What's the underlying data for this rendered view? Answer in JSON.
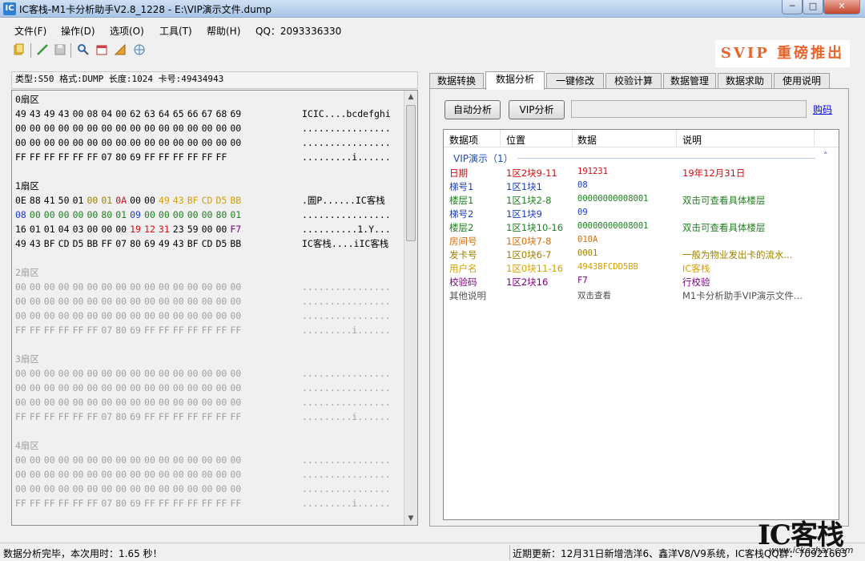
{
  "window": {
    "title": "IC客栈-M1卡分析助手V2.8_1228 -  E:\\VIP演示文件.dump",
    "controls": {
      "minimize": "─",
      "maximize": "□",
      "close": "✕"
    },
    "icon_text": "IC"
  },
  "menu": [
    "文件(F)",
    "操作(D)",
    "选项(O)",
    "工具(T)",
    "帮助(H)",
    "QQ：2093336330"
  ],
  "toolbar_icons": [
    "open-folder-icon",
    "save-disk-icon",
    "edit-pen-icon",
    "disabled-save-icon",
    "search-icon",
    "calendar-icon",
    "chart-icon",
    "network-icon"
  ],
  "banner": "SVIP 重磅推出",
  "info_line": "类型:S50 格式:DUMP 长度:1024 卡号:49434943",
  "sectors": [
    {
      "title": "0扇区",
      "dim": false,
      "rows": [
        {
          "bytes": [
            "49",
            "43",
            "49",
            "43",
            "00",
            "08",
            "04",
            "00",
            "62",
            "63",
            "64",
            "65",
            "66",
            "67",
            "68",
            "69"
          ],
          "ascii": "ICIC....bcdefghi"
        },
        {
          "bytes": [
            "00",
            "00",
            "00",
            "00",
            "00",
            "00",
            "00",
            "00",
            "00",
            "00",
            "00",
            "00",
            "00",
            "00",
            "00",
            "00"
          ],
          "ascii": "................"
        },
        {
          "bytes": [
            "00",
            "00",
            "00",
            "00",
            "00",
            "00",
            "00",
            "00",
            "00",
            "00",
            "00",
            "00",
            "00",
            "00",
            "00",
            "00"
          ],
          "ascii": "................"
        },
        {
          "bytes": [
            "FF",
            "FF",
            "FF",
            "FF",
            "FF",
            "FF",
            "07",
            "80",
            "69",
            "FF",
            "FF",
            "FF",
            "FF",
            "FF",
            "FF"
          ],
          "ascii": ".........i......"
        }
      ]
    },
    {
      "title": "1扇区",
      "dim": false,
      "rows": [
        {
          "bytes": [
            "0E",
            "88",
            "41",
            "50",
            "01",
            "00",
            "01",
            "0A",
            "00",
            "00",
            "49",
            "43",
            "BF",
            "CD",
            "D5",
            "BB"
          ],
          "colors": [
            "",
            "",
            "",
            "",
            "",
            "#a08000",
            "#a08000",
            "#d01010",
            "",
            "",
            "#d6a000",
            "#d6a000",
            "#d6a000",
            "#d6a000",
            "#d6a000",
            "#d6a000"
          ],
          "ascii": ".圄P......IC客栈"
        },
        {
          "bytes": [
            "08",
            "00",
            "00",
            "00",
            "00",
            "00",
            "80",
            "01",
            "09",
            "00",
            "00",
            "00",
            "00",
            "00",
            "80",
            "01"
          ],
          "colors": [
            "#1a3fc0",
            "#208020",
            "#208020",
            "#208020",
            "#208020",
            "#208020",
            "#208020",
            "#208020",
            "#1a3fc0",
            "#208020",
            "#208020",
            "#208020",
            "#208020",
            "#208020",
            "#208020",
            "#208020"
          ],
          "ascii": "................"
        },
        {
          "bytes": [
            "16",
            "01",
            "01",
            "04",
            "03",
            "00",
            "00",
            "00",
            "19",
            "12",
            "31",
            "23",
            "59",
            "00",
            "00",
            "F7"
          ],
          "colors": [
            "",
            "",
            "",
            "",
            "",
            "",
            "",
            "",
            "#d01010",
            "#d01010",
            "#d01010",
            "",
            "",
            "",
            "",
            "#800080"
          ],
          "ascii": "..........1.Y..."
        },
        {
          "bytes": [
            "49",
            "43",
            "BF",
            "CD",
            "D5",
            "BB",
            "FF",
            "07",
            "80",
            "69",
            "49",
            "43",
            "BF",
            "CD",
            "D5",
            "BB"
          ],
          "ascii": "IC客栈....iIC客栈"
        }
      ]
    },
    {
      "title": "2扇区",
      "dim": true,
      "rows": [
        {
          "bytes": [
            "00",
            "00",
            "00",
            "00",
            "00",
            "00",
            "00",
            "00",
            "00",
            "00",
            "00",
            "00",
            "00",
            "00",
            "00",
            "00"
          ],
          "ascii": "................"
        },
        {
          "bytes": [
            "00",
            "00",
            "00",
            "00",
            "00",
            "00",
            "00",
            "00",
            "00",
            "00",
            "00",
            "00",
            "00",
            "00",
            "00",
            "00"
          ],
          "ascii": "................"
        },
        {
          "bytes": [
            "00",
            "00",
            "00",
            "00",
            "00",
            "00",
            "00",
            "00",
            "00",
            "00",
            "00",
            "00",
            "00",
            "00",
            "00",
            "00"
          ],
          "ascii": "................"
        },
        {
          "bytes": [
            "FF",
            "FF",
            "FF",
            "FF",
            "FF",
            "FF",
            "07",
            "80",
            "69",
            "FF",
            "FF",
            "FF",
            "FF",
            "FF",
            "FF",
            "FF"
          ],
          "ascii": ".........i......"
        }
      ]
    },
    {
      "title": "3扇区",
      "dim": true,
      "rows": [
        {
          "bytes": [
            "00",
            "00",
            "00",
            "00",
            "00",
            "00",
            "00",
            "00",
            "00",
            "00",
            "00",
            "00",
            "00",
            "00",
            "00",
            "00"
          ],
          "ascii": "................"
        },
        {
          "bytes": [
            "00",
            "00",
            "00",
            "00",
            "00",
            "00",
            "00",
            "00",
            "00",
            "00",
            "00",
            "00",
            "00",
            "00",
            "00",
            "00"
          ],
          "ascii": "................"
        },
        {
          "bytes": [
            "00",
            "00",
            "00",
            "00",
            "00",
            "00",
            "00",
            "00",
            "00",
            "00",
            "00",
            "00",
            "00",
            "00",
            "00",
            "00"
          ],
          "ascii": "................"
        },
        {
          "bytes": [
            "FF",
            "FF",
            "FF",
            "FF",
            "FF",
            "FF",
            "07",
            "80",
            "69",
            "FF",
            "FF",
            "FF",
            "FF",
            "FF",
            "FF",
            "FF"
          ],
          "ascii": ".........i......"
        }
      ]
    },
    {
      "title": "4扇区",
      "dim": true,
      "rows": [
        {
          "bytes": [
            "00",
            "00",
            "00",
            "00",
            "00",
            "00",
            "00",
            "00",
            "00",
            "00",
            "00",
            "00",
            "00",
            "00",
            "00",
            "00"
          ],
          "ascii": "................"
        },
        {
          "bytes": [
            "00",
            "00",
            "00",
            "00",
            "00",
            "00",
            "00",
            "00",
            "00",
            "00",
            "00",
            "00",
            "00",
            "00",
            "00",
            "00"
          ],
          "ascii": "................"
        },
        {
          "bytes": [
            "00",
            "00",
            "00",
            "00",
            "00",
            "00",
            "00",
            "00",
            "00",
            "00",
            "00",
            "00",
            "00",
            "00",
            "00",
            "00"
          ],
          "ascii": "................"
        },
        {
          "bytes": [
            "FF",
            "FF",
            "FF",
            "FF",
            "FF",
            "FF",
            "07",
            "80",
            "69",
            "FF",
            "FF",
            "FF",
            "FF",
            "FF",
            "FF",
            "FF"
          ],
          "ascii": ".........i......"
        }
      ]
    }
  ],
  "tabs": [
    "数据转换",
    "数据分析",
    "一键修改",
    "校验计算",
    "数据管理",
    "数据求助",
    "使用说明"
  ],
  "active_tab": "数据分析",
  "analysis": {
    "auto_button": "自动分析",
    "vip_button": "VIP分析",
    "buy_link": "购码",
    "columns": [
      "数据项",
      "位置",
      "数据",
      "说明"
    ],
    "group": "VIP演示（1）",
    "group_toggle": "˄",
    "rows": [
      {
        "item": "日期",
        "pos": "1区2块9-11",
        "data": "191231",
        "desc": "19年12月31日",
        "color": "#d01010"
      },
      {
        "item": "梯号1",
        "pos": "1区1块1",
        "data": "08",
        "desc": "",
        "color": "#1a3fc0"
      },
      {
        "item": "楼层1",
        "pos": "1区1块2-8",
        "data": "00000000008001",
        "desc": "双击可查看具体楼层",
        "color": "#208020"
      },
      {
        "item": "梯号2",
        "pos": "1区1块9",
        "data": "09",
        "desc": "",
        "color": "#1a3fc0"
      },
      {
        "item": "楼层2",
        "pos": "1区1块10-16",
        "data": "00000000008001",
        "desc": "双击可查看具体楼层",
        "color": "#208020"
      },
      {
        "item": "房间号",
        "pos": "1区0块7-8",
        "data": "010A",
        "desc": "",
        "color": "#d07010"
      },
      {
        "item": "发卡号",
        "pos": "1区0块6-7",
        "data": "0001",
        "desc": "一般为物业发出卡的流水...",
        "color": "#a08000"
      },
      {
        "item": "用户名",
        "pos": "1区0块11-16",
        "data": "4943BFCDD5BB",
        "desc": "IC客栈",
        "color": "#d6a000"
      },
      {
        "item": "校验码",
        "pos": "1区2块16",
        "data": "F7",
        "desc": "行校验",
        "color": "#800080"
      },
      {
        "item": "其他说明",
        "pos": "",
        "data": "双击查看",
        "desc": "M1卡分析助手VIP演示文件...",
        "color": "#505050"
      }
    ]
  },
  "status": {
    "left": "数据分析完毕，本次用时：1.65 秒！",
    "right": "近期更新：12月31日新增浩洋6、鑫洋V8/V9系统，IC客栈QQ群：70921663"
  },
  "watermark": {
    "brand": "IC客栈",
    "url": "www.ickezhan.com"
  }
}
